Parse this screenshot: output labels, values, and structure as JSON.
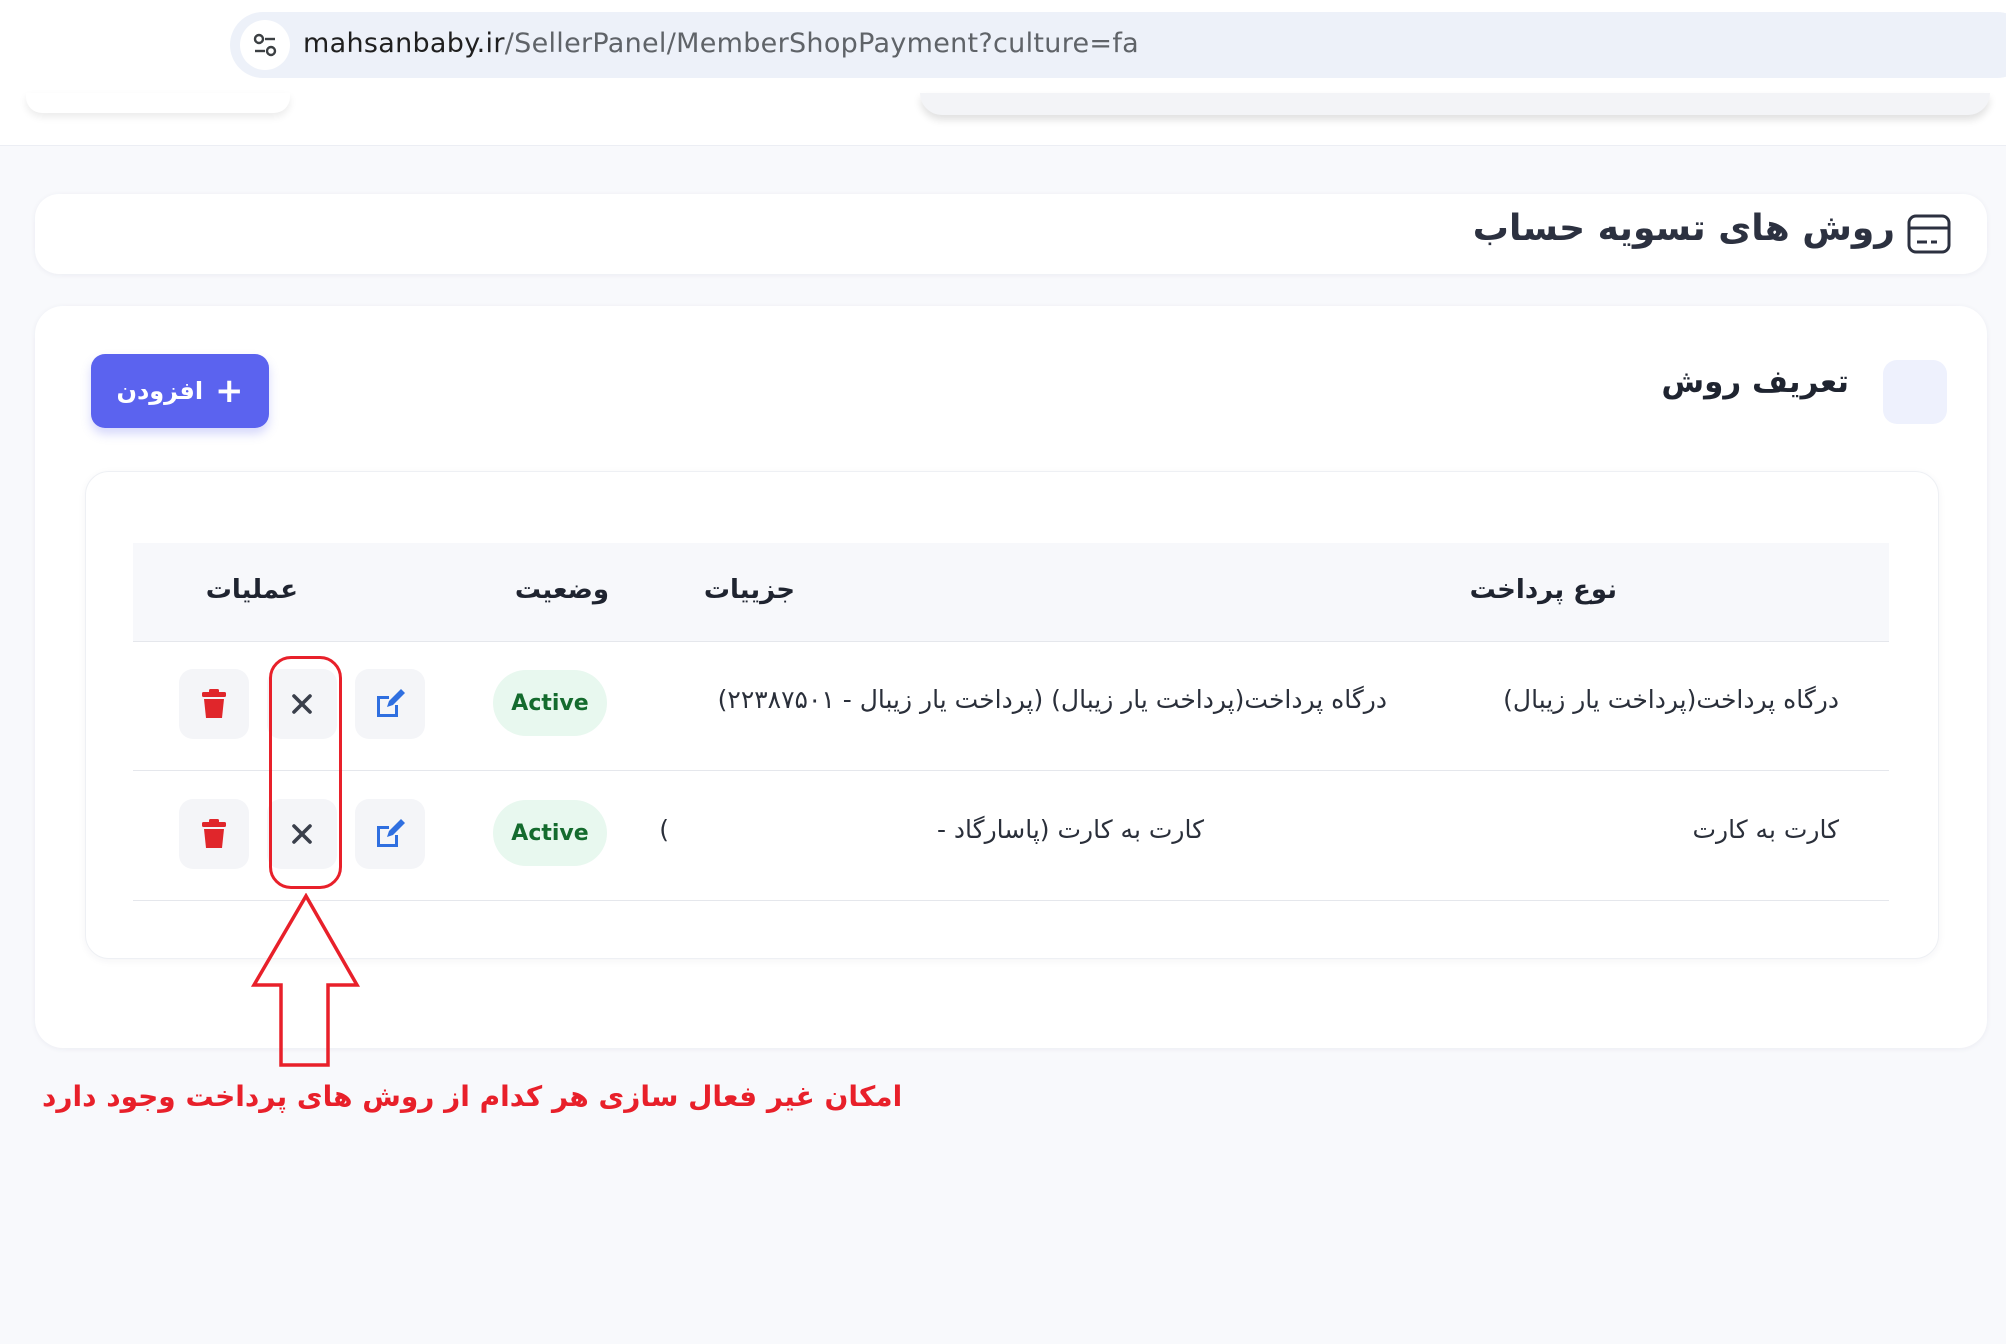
{
  "browser": {
    "url_domain": "mahsanbaby.ir",
    "url_path": "/SellerPanel/MemberShopPayment?culture=fa",
    "site_info_icon": "tune-icon"
  },
  "page": {
    "title": "روش های تسویه حساب",
    "title_icon": "credit-card-icon"
  },
  "section": {
    "define_label": "تعریف روش",
    "add_button": "افزودن",
    "add_icon": "plus-icon"
  },
  "table": {
    "headers": {
      "payment_type": "نوع پرداخت",
      "details": "جزییات",
      "status": "وضعیت",
      "operations": "عملیات"
    },
    "rows": [
      {
        "payment_type": "درگاه پرداخت(پرداخت یار زیبال)",
        "details": "درگاه پرداخت(پرداخت یار زیبال) (پرداخت یار زیبال - ۲۲۳۸۷۵۰۱)",
        "details_extra": "",
        "status": "Active"
      },
      {
        "payment_type": "کارت به کارت",
        "details": "کارت به کارت (پاسارگاد -",
        "details_extra": ")",
        "status": "Active"
      }
    ],
    "action_icons": [
      "edit-icon",
      "deactivate-x-icon",
      "trash-icon"
    ]
  },
  "annotation": {
    "text": "امکان غیر فعال سازی هر کدام از روش های پرداخت وجود دارد",
    "color": "#e8202a"
  },
  "colors": {
    "primary": "#5b63ef",
    "active_badge_bg": "#e8f8ef",
    "active_badge_text": "#146b2e",
    "edit_icon": "#2f6fe0",
    "delete_icon": "#e0262b"
  }
}
